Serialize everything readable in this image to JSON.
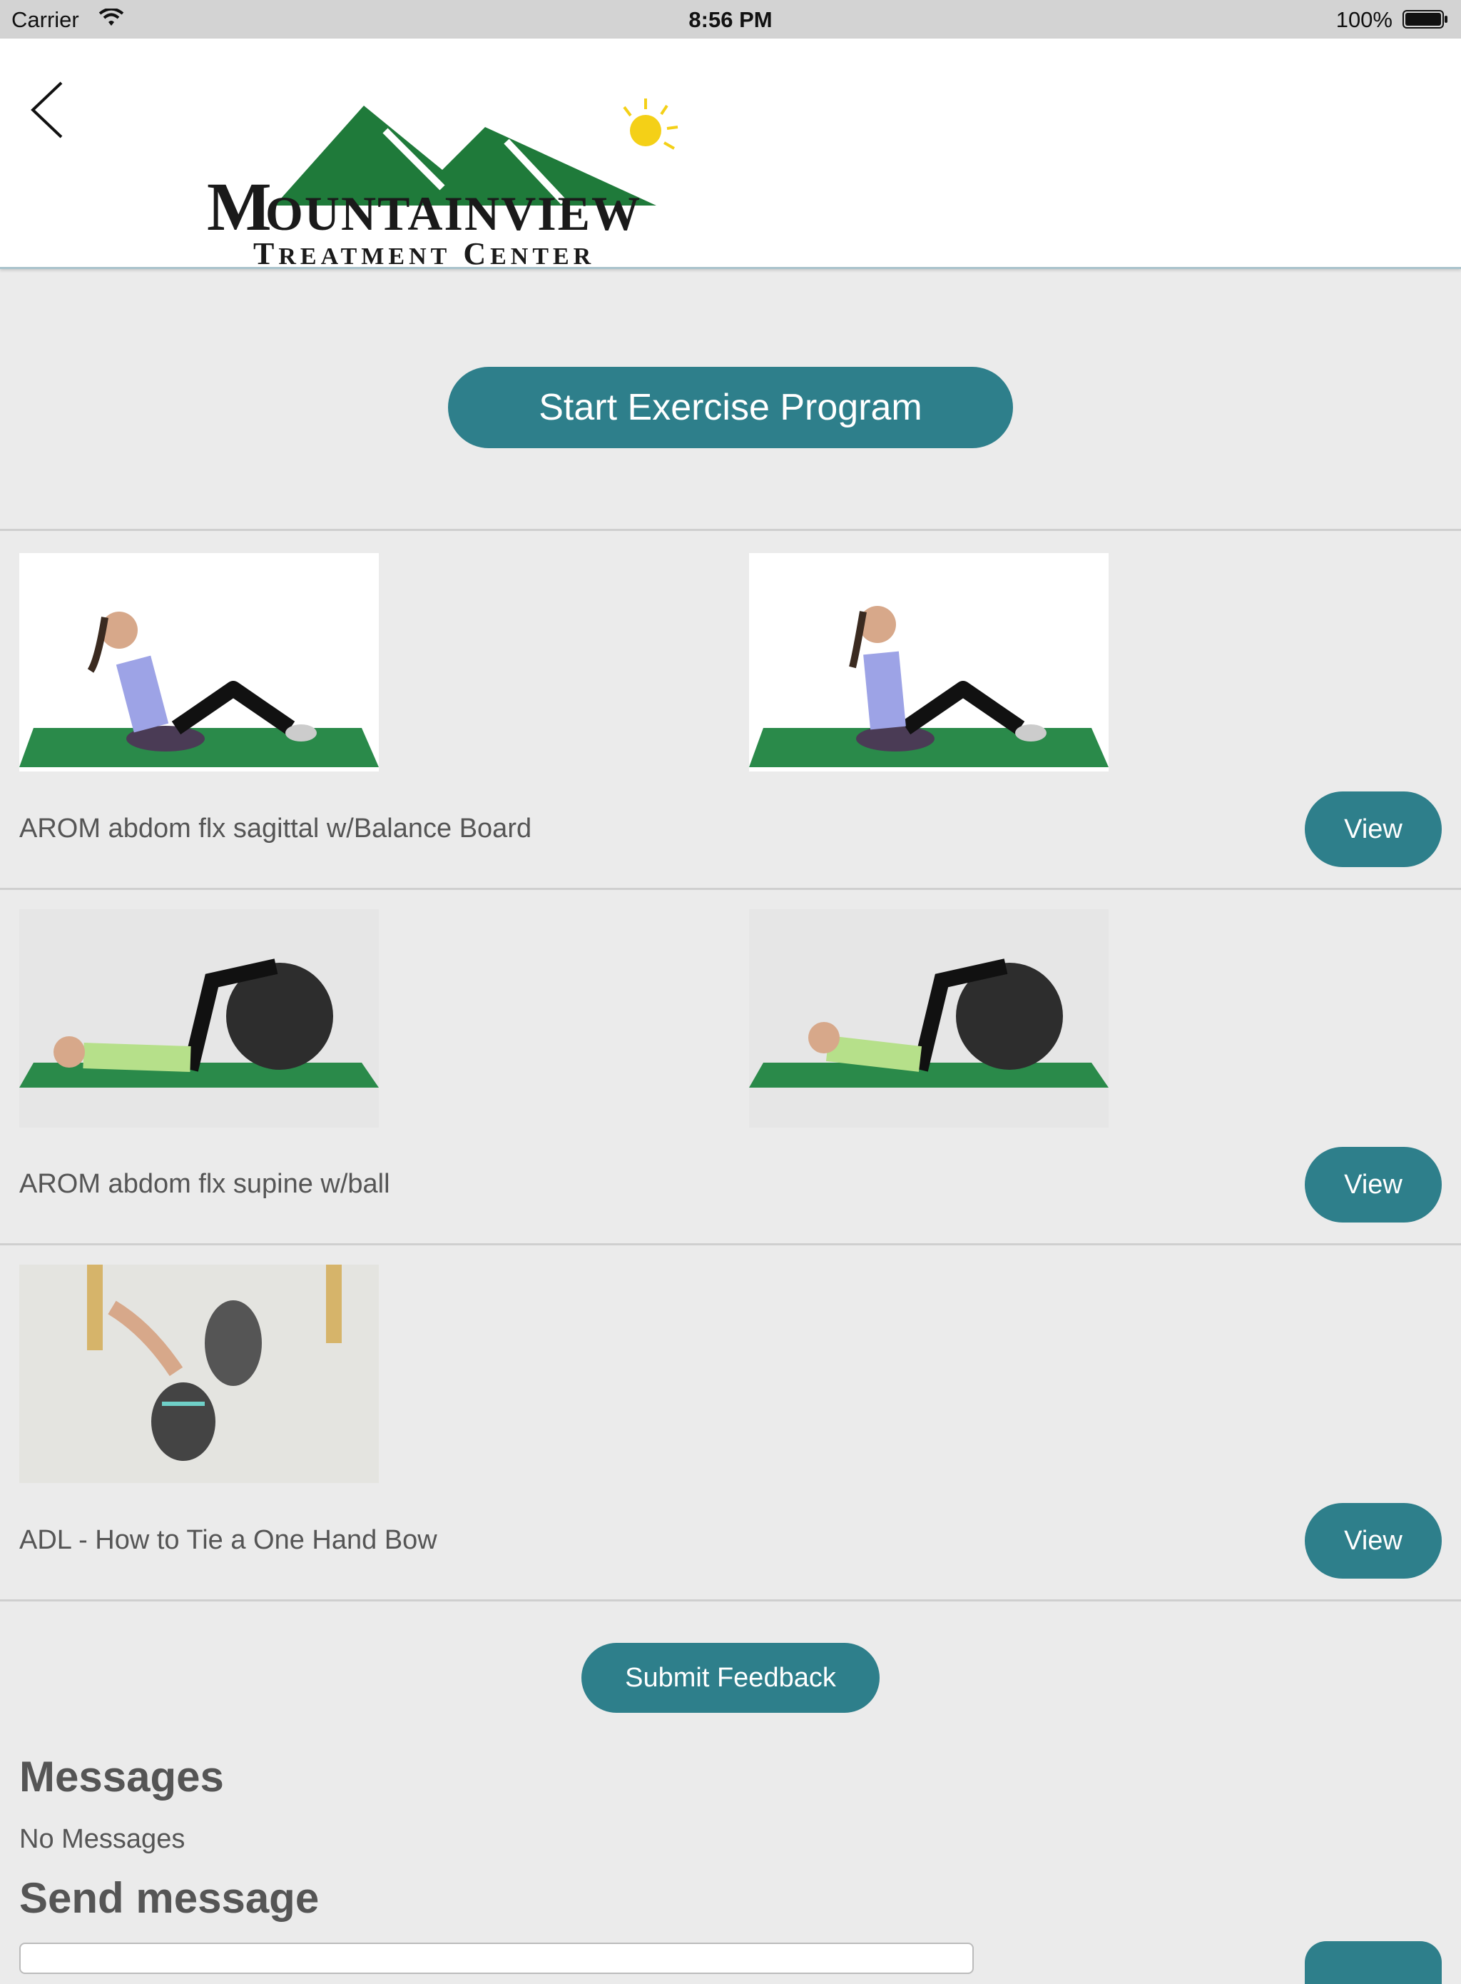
{
  "status_bar": {
    "carrier": "Carrier",
    "time": "8:56 PM",
    "battery": "100%"
  },
  "header": {
    "logo_text_main": "Mountainview",
    "logo_text_sub": "Treatment Center"
  },
  "program": {
    "start_label": "Start Exercise Program"
  },
  "exercises": [
    {
      "name": "AROM abdom flx sagittal w/Balance Board",
      "view_label": "View"
    },
    {
      "name": "AROM abdom flx supine w/ball",
      "view_label": "View"
    },
    {
      "name": "ADL - How to Tie a One Hand Bow",
      "view_label": "View"
    }
  ],
  "feedback": {
    "label": "Submit Feedback"
  },
  "messages": {
    "title": "Messages",
    "empty_text": "No Messages",
    "send_title": "Send message"
  },
  "colors": {
    "accent": "#2e7f8b",
    "background": "#ebebeb",
    "mat_green": "#2a8a4a"
  }
}
